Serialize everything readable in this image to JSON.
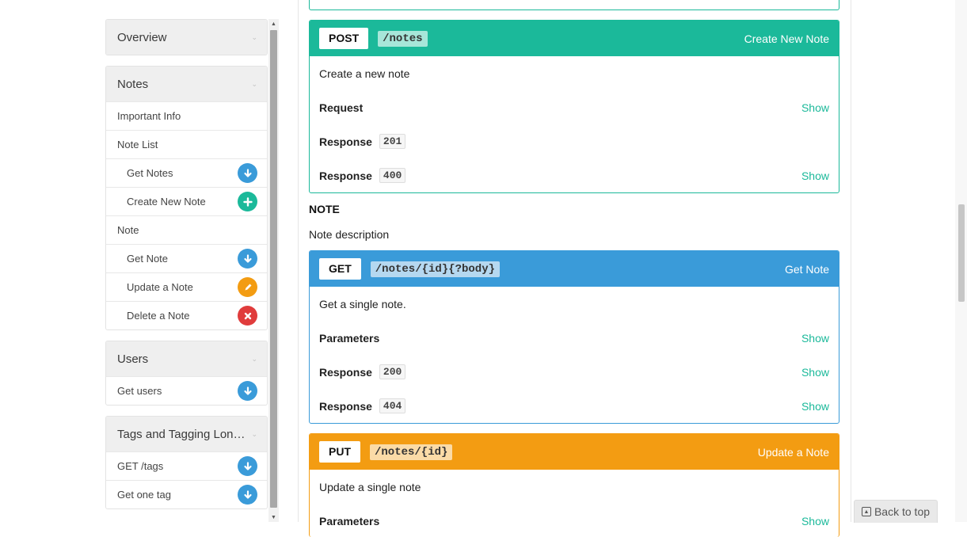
{
  "sidebar": {
    "groups": [
      {
        "label": "Overview",
        "items": []
      },
      {
        "label": "Notes",
        "items": [
          {
            "label": "Important Info"
          },
          {
            "label": "Note List"
          },
          {
            "label": "Get Notes",
            "badge": "get"
          },
          {
            "label": "Create New Note",
            "badge": "post"
          },
          {
            "label": "Note"
          },
          {
            "label": "Get Note",
            "badge": "get"
          },
          {
            "label": "Update a Note",
            "badge": "put"
          },
          {
            "label": "Delete a Note",
            "badge": "delete"
          }
        ]
      },
      {
        "label": "Users",
        "items": [
          {
            "label": "Get users",
            "badge": "get"
          }
        ]
      },
      {
        "label": "Tags and Tagging Long T...",
        "items": [
          {
            "label": "GET /tags",
            "badge": "get"
          },
          {
            "label": "Get one tag",
            "badge": "get"
          }
        ]
      }
    ]
  },
  "cards": {
    "post_notes": {
      "method": "POST",
      "path": "/notes",
      "title": "Create New Note",
      "description": "Create a new note",
      "rows": [
        {
          "label": "Request",
          "code": "",
          "show": "Show"
        },
        {
          "label": "Response",
          "code": "201",
          "show": ""
        },
        {
          "label": "Response",
          "code": "400",
          "show": "Show"
        }
      ]
    },
    "get_note": {
      "method": "GET",
      "path": "/notes/{id}{?body}",
      "title": "Get Note",
      "description": "Get a single note.",
      "rows": [
        {
          "label": "Parameters",
          "code": "",
          "show": "Show"
        },
        {
          "label": "Response",
          "code": "200",
          "show": "Show"
        },
        {
          "label": "Response",
          "code": "404",
          "show": "Show"
        }
      ]
    },
    "put_note": {
      "method": "PUT",
      "path": "/notes/{id}",
      "title": "Update a Note",
      "description": "Update a single note",
      "rows": [
        {
          "label": "Parameters",
          "code": "",
          "show": "Show"
        }
      ]
    }
  },
  "section": {
    "title": "NOTE",
    "description": "Note description"
  },
  "back_to_top": "Back to top",
  "colors": {
    "get": "#3a9bd9",
    "post": "#1bb99a",
    "put": "#f39c12",
    "delete": "#e03c3c"
  },
  "icons": {
    "get": "arrow-down-icon",
    "post": "plus-icon",
    "put": "pencil-icon",
    "delete": "close-icon"
  }
}
